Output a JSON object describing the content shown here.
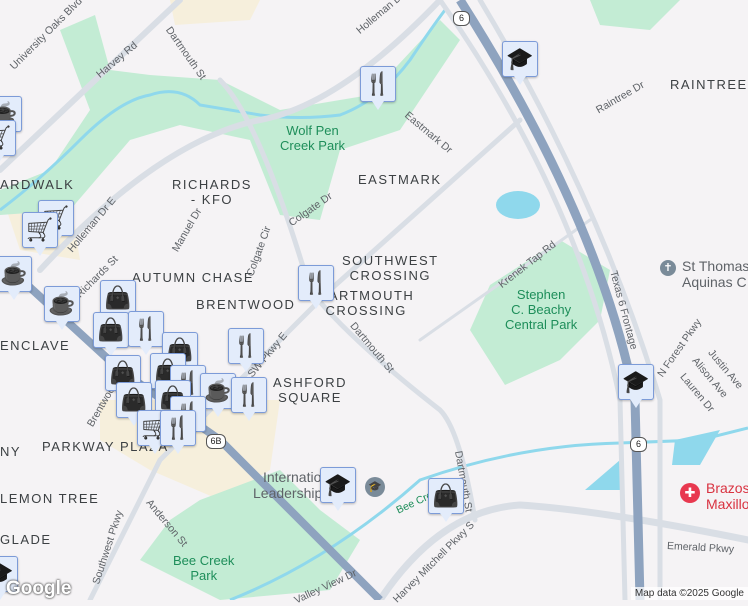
{
  "neighborhoods": [
    "ARDWALK",
    "RICHARDS\n- KFO",
    "EASTMARK",
    "SOUTHWEST\nCROSSING",
    "AUTUMN CHASE",
    "BRENTWOOD",
    "DARTMOUTH\nCROSSING",
    "ENCLAVE",
    "ASHFORD\nSQUARE",
    "PARKWAY PLAZA",
    "NY",
    "LEMON TREE",
    "GLADE",
    "RAINTREE"
  ],
  "parks": [
    "Wolf Pen\nCreek Park",
    "Stephen\nC. Beachy\nCentral Park",
    "Bee Creek\nPark"
  ],
  "streets": [
    "University Oaks Blvd",
    "Harvey Rd",
    "Dartmouth St",
    "Holleman Dr",
    "Eastmark Dr",
    "Colgate Dr",
    "Colgate Cir",
    "Manuel Dr",
    "Holleman Dr E",
    "Richards St",
    "Krenek Tap Rd",
    "Raintree Dr",
    "Dartmouth St",
    "Dartmouth St",
    "Texas 6 Frontage",
    "N Forest Pkwy",
    "Justin Ave",
    "Alison Ave",
    "Lauren Dr",
    "Southwest Pkwy",
    "Anderson St",
    "Harvey Mitchell Pkwy S",
    "Emerald Pkwy",
    "Bee Creek",
    "Valley View Dr",
    "Brentwood",
    "SW Pkwy E"
  ],
  "pois": {
    "church": "St Thomas\nAquinas C",
    "school": "International\nLeadership of T",
    "clinic": "Brazos\nMaxillo"
  },
  "shields": [
    "6",
    "6",
    "6B"
  ],
  "markers": [
    "restaurant",
    "school",
    "coffee",
    "shopping-cart",
    "shopping-cart",
    "shopping-cart",
    "coffee",
    "coffee",
    "shopping-bag",
    "shopping-bag",
    "restaurant",
    "shopping-bag",
    "shopping-bag",
    "shopping-bag",
    "restaurant",
    "coffee",
    "restaurant",
    "restaurant",
    "shopping-bag",
    "shopping-bag",
    "restaurant",
    "shopping-cart",
    "restaurant",
    "restaurant",
    "school",
    "shopping-bag",
    "school",
    "school"
  ],
  "branding": {
    "logo": "Google",
    "attribution": "Map data ©2025 Google"
  },
  "colors": {
    "park": "#c3ecd4",
    "water": "#8fd8ec",
    "highway": "#8ea3bf",
    "road": "#d9dee5",
    "commercial": "#f6efdc",
    "marker_icon": "#0b4468"
  }
}
